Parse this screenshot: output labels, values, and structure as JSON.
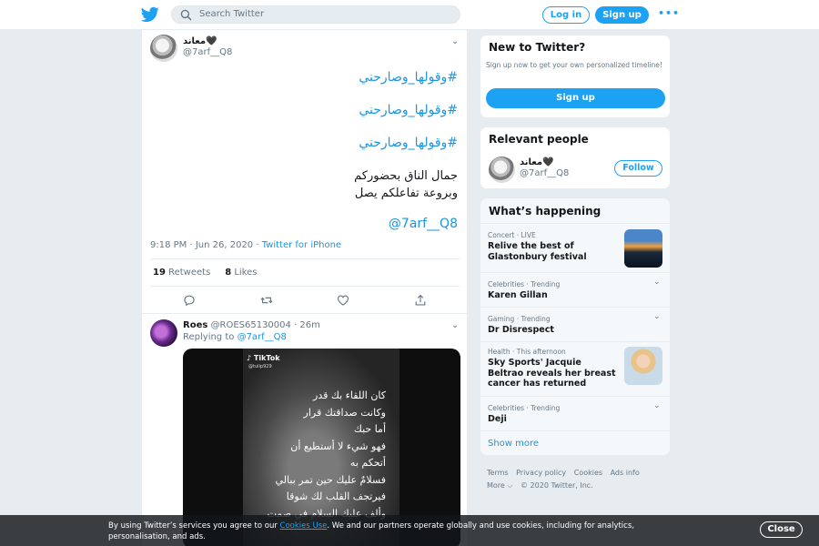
{
  "header": {
    "search_placeholder": "Search Twitter",
    "login_label": "Log in",
    "signup_label": "Sign up",
    "more_label": "•••"
  },
  "tweet": {
    "author_name": "معاند🖤",
    "author_handle": "@7arf__Q8",
    "hashtags": [
      "#وقولها_وصارحني",
      "#وقولها_وصارحني",
      "#وقولها_وصارحني"
    ],
    "text_line1": "جمال الناق بحضوركم",
    "text_line2": "وبروعة تفاعلكم يصل",
    "mention": "@7arf__Q8",
    "time": "9:18 PM · Jun 26, 2020 · ",
    "source": "Twitter for iPhone",
    "retweets_count": "19",
    "retweets_label": "Retweets",
    "likes_count": "8",
    "likes_label": "Likes"
  },
  "reply": {
    "author_name": "Roes",
    "author_handle": "@ROES65130004 · 26m",
    "replying_prefix": "Replying to ",
    "replying_handle": "@7arf__Q8",
    "tiktok_label": "TikTok",
    "tiktok_user": "@tulip929",
    "poem_lines": [
      "كان اللقاء بك قدر",
      "وكانت صداقتك قرار",
      "أما حبك",
      "فهو شيء لا أستطيع أن",
      "أتحكم به",
      "فسلامٌ عليك حين تمر ببالي",
      "فيرتجف القلب لك شوقا",
      "وألف عليك السلام في صمت"
    ]
  },
  "sidebar": {
    "new_title": "New to Twitter?",
    "new_sub": "Sign up now to get your own personalized timeline!",
    "new_signup": "Sign up",
    "relevant_title": "Relevant people",
    "rp_name": "معاند🖤",
    "rp_handle": "@7arf__Q8",
    "follow_label": "Follow",
    "happening_title": "What’s happening",
    "trends": [
      {
        "context": "Concert · LIVE",
        "name": "Relive the best of Glastonbury festival"
      },
      {
        "context": "Celebrities · Trending",
        "name": "Karen Gillan"
      },
      {
        "context": "Gaming · Trending",
        "name": "Dr Disrespect"
      },
      {
        "context": "Health · This afternoon",
        "name": "Sky Sports' Jacquie Beltrao reveals her breast cancer has returned"
      },
      {
        "context": "Celebrities · Trending",
        "name": "Deji"
      }
    ],
    "show_more": "Show more",
    "footer_links": [
      "Terms",
      "Privacy policy",
      "Cookies",
      "Ads info"
    ],
    "footer_more": "More ⌵",
    "copyright": "© 2020 Twitter, Inc."
  },
  "cookie": {
    "text_before": "By using Twitter’s services you agree to our ",
    "link": "Cookies Use",
    "text_after": ". We and our partners operate globally and use cookies, including for analytics, personalisation, and ads.",
    "close_label": "Close"
  },
  "colors": {
    "accent": "#1da1f2",
    "background": "#e6ecf0"
  }
}
